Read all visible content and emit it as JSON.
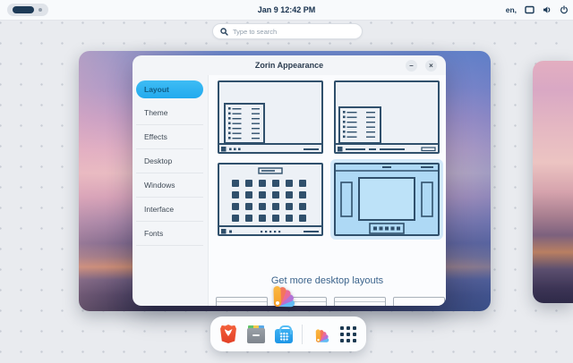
{
  "top_bar": {
    "clock": "Jan 9 12:42 PM",
    "keyboard_indicator": "en,",
    "status_icons": [
      "display",
      "volume",
      "power"
    ],
    "workspaces": {
      "active_index": 0,
      "count": 2
    }
  },
  "search": {
    "placeholder": "Type to search"
  },
  "appearance_window": {
    "title": "Zorin Appearance",
    "controls": {
      "minimize": "–",
      "close": "×"
    },
    "sidebar": [
      {
        "label": "Layout",
        "selected": true
      },
      {
        "label": "Theme",
        "selected": false
      },
      {
        "label": "Effects",
        "selected": false
      },
      {
        "label": "Desktop",
        "selected": false
      },
      {
        "label": "Windows",
        "selected": false
      },
      {
        "label": "Interface",
        "selected": false
      },
      {
        "label": "Fonts",
        "selected": false
      }
    ],
    "layout_options": [
      {
        "name": "windows-like-app-menu",
        "selected": false
      },
      {
        "name": "windows-like-window-list",
        "selected": false
      },
      {
        "name": "touch-fullscreen-grid",
        "selected": false
      },
      {
        "name": "gnome-activities",
        "selected": true
      }
    ],
    "more_layouts_label": "Get more desktop layouts"
  },
  "dock": {
    "items": [
      {
        "icon": "brave-browser-icon",
        "running": false
      },
      {
        "icon": "file-drawer-icon",
        "running": false
      },
      {
        "icon": "software-store-icon",
        "running": false
      },
      {
        "icon": "zorin-appearance-icon",
        "running": true
      },
      {
        "icon": "app-grid-icon",
        "running": false
      }
    ]
  },
  "colors": {
    "accent_blue": "#2fb3f0",
    "selection_blue": "#aed9f5",
    "thumbnail_stroke": "#30506c",
    "top_bar_bg": "#f8fafc",
    "overview_bg": "#e9ebef",
    "text_dark": "#16304d"
  }
}
